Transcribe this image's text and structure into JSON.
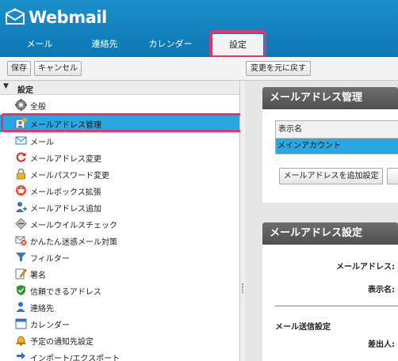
{
  "app": {
    "title": "Webmail"
  },
  "tabs": [
    {
      "label": "メール"
    },
    {
      "label": "連絡先"
    },
    {
      "label": "カレンダー"
    },
    {
      "label": "設定",
      "active": true
    }
  ],
  "toolbar": {
    "save_label": "保存",
    "cancel_label": "キャンセル",
    "revert_label": "変更を元に戻す"
  },
  "tree": {
    "root_label": "設定",
    "items": [
      {
        "label": "全般",
        "icon": "gear-icon"
      },
      {
        "label": "メールアドレス管理",
        "icon": "address-manage-icon",
        "selected": true
      },
      {
        "label": "メール",
        "icon": "envelope-icon"
      },
      {
        "label": "メールアドレス変更",
        "icon": "refresh-icon"
      },
      {
        "label": "メールパスワード変更",
        "icon": "lock-icon"
      },
      {
        "label": "メールボックス拡張",
        "icon": "mailbox-icon"
      },
      {
        "label": "メールアドレス追加",
        "icon": "add-user-icon"
      },
      {
        "label": "メールウイルスチェック",
        "icon": "virus-check-icon"
      },
      {
        "label": "かんたん迷惑メール対策",
        "icon": "spam-icon"
      },
      {
        "label": "フィルター",
        "icon": "filter-icon"
      },
      {
        "label": "署名",
        "icon": "signature-icon"
      },
      {
        "label": "信頼できるアドレス",
        "icon": "shield-icon"
      },
      {
        "label": "連絡先",
        "icon": "contact-icon"
      },
      {
        "label": "カレンダー",
        "icon": "calendar-icon"
      },
      {
        "label": "予定の通知先設定",
        "icon": "bell-icon"
      },
      {
        "label": "インポート/エクスポート",
        "icon": "import-export-icon"
      }
    ]
  },
  "panel_address": {
    "title": "メールアドレス管理",
    "col_header": "表示名",
    "row": "メインアカウント",
    "add_button": "メールアドレスを追加設定"
  },
  "panel_settings": {
    "title": "メールアドレス設定",
    "email_label": "メールアドレス:",
    "display_label": "表示名:",
    "section": "メール送信設定",
    "sender_label": "差出人:"
  },
  "colors": {
    "header": "#1484c0",
    "selection": "#29a7e1",
    "highlight": "#e8336d",
    "panel_head": "#5e5e5e"
  }
}
